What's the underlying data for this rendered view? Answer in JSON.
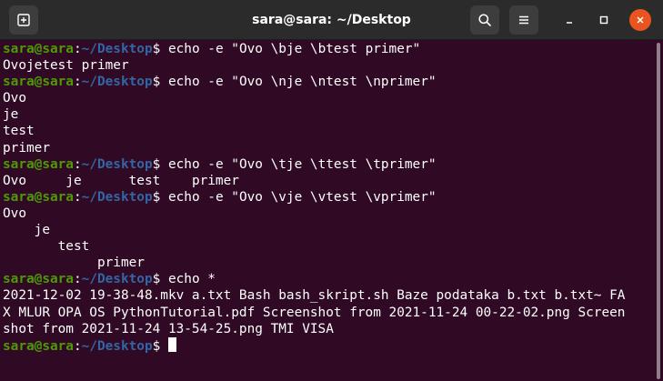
{
  "window": {
    "title": "sara@sara: ~/Desktop",
    "accent_close": "#e95420"
  },
  "titlebar": {
    "icons": [
      "new-tab-icon",
      "search-icon",
      "hamburger-menu-icon",
      "minimize-icon",
      "maximize-icon",
      "close-icon"
    ]
  },
  "terminal": {
    "colors": {
      "background": "#300a24",
      "user": "#4e9a06",
      "path": "#3465a4",
      "text": "#ffffff"
    },
    "prompt_user": "sara@sara",
    "prompt_sep": ":",
    "prompt_path": "~/Desktop",
    "prompt_end": "$ ",
    "lines": [
      {
        "type": "prompt",
        "cmd": "echo -e \"Ovo \\bje \\btest primer\""
      },
      {
        "type": "output",
        "text": "Ovojetest primer"
      },
      {
        "type": "prompt",
        "cmd": "echo -e \"Ovo \\nje \\ntest \\nprimer\""
      },
      {
        "type": "output",
        "text": "Ovo"
      },
      {
        "type": "output",
        "text": "je"
      },
      {
        "type": "output",
        "text": "test"
      },
      {
        "type": "output",
        "text": "primer"
      },
      {
        "type": "prompt",
        "cmd": "echo -e \"Ovo \\tje \\ttest \\tprimer\""
      },
      {
        "type": "output",
        "text": "Ovo \tje \ttest \tprimer"
      },
      {
        "type": "prompt",
        "cmd": "echo -e \"Ovo \\vje \\vtest \\vprimer\""
      },
      {
        "type": "output",
        "text": "Ovo"
      },
      {
        "type": "output",
        "text": "    je"
      },
      {
        "type": "output",
        "text": "       test"
      },
      {
        "type": "output",
        "text": "            primer"
      },
      {
        "type": "prompt",
        "cmd": "echo *"
      },
      {
        "type": "output",
        "text": "2021-12-02 19-38-48.mkv a.txt Bash bash_skript.sh Baze podataka b.txt b.txt~ FA"
      },
      {
        "type": "output",
        "text": "X MLUR OPA OS PythonTutorial.pdf Screenshot from 2021-11-24 00-22-02.png Screen"
      },
      {
        "type": "output",
        "text": "shot from 2021-11-24 13-54-25.png TMI VISA"
      },
      {
        "type": "prompt",
        "cmd": "",
        "cursor": true
      }
    ]
  }
}
